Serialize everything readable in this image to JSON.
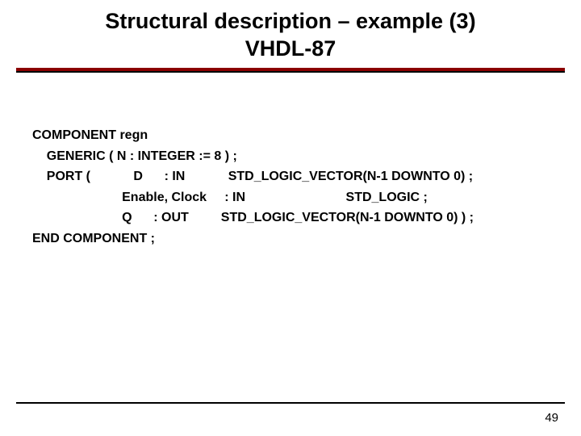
{
  "title": {
    "line1": "Structural description – example (3)",
    "line2": "VHDL-87"
  },
  "code": {
    "l1": "COMPONENT regn",
    "l2": "    GENERIC ( N : INTEGER := 8 ) ;",
    "l3": "    PORT (            D      : IN            STD_LOGIC_VECTOR(N-1 DOWNTO 0) ;",
    "l4": "                         Enable, Clock     : IN                            STD_LOGIC ;",
    "l5": "                         Q      : OUT         STD_LOGIC_VECTOR(N-1 DOWNTO 0) ) ;",
    "l6": "END COMPONENT ;"
  },
  "page_number": "49"
}
